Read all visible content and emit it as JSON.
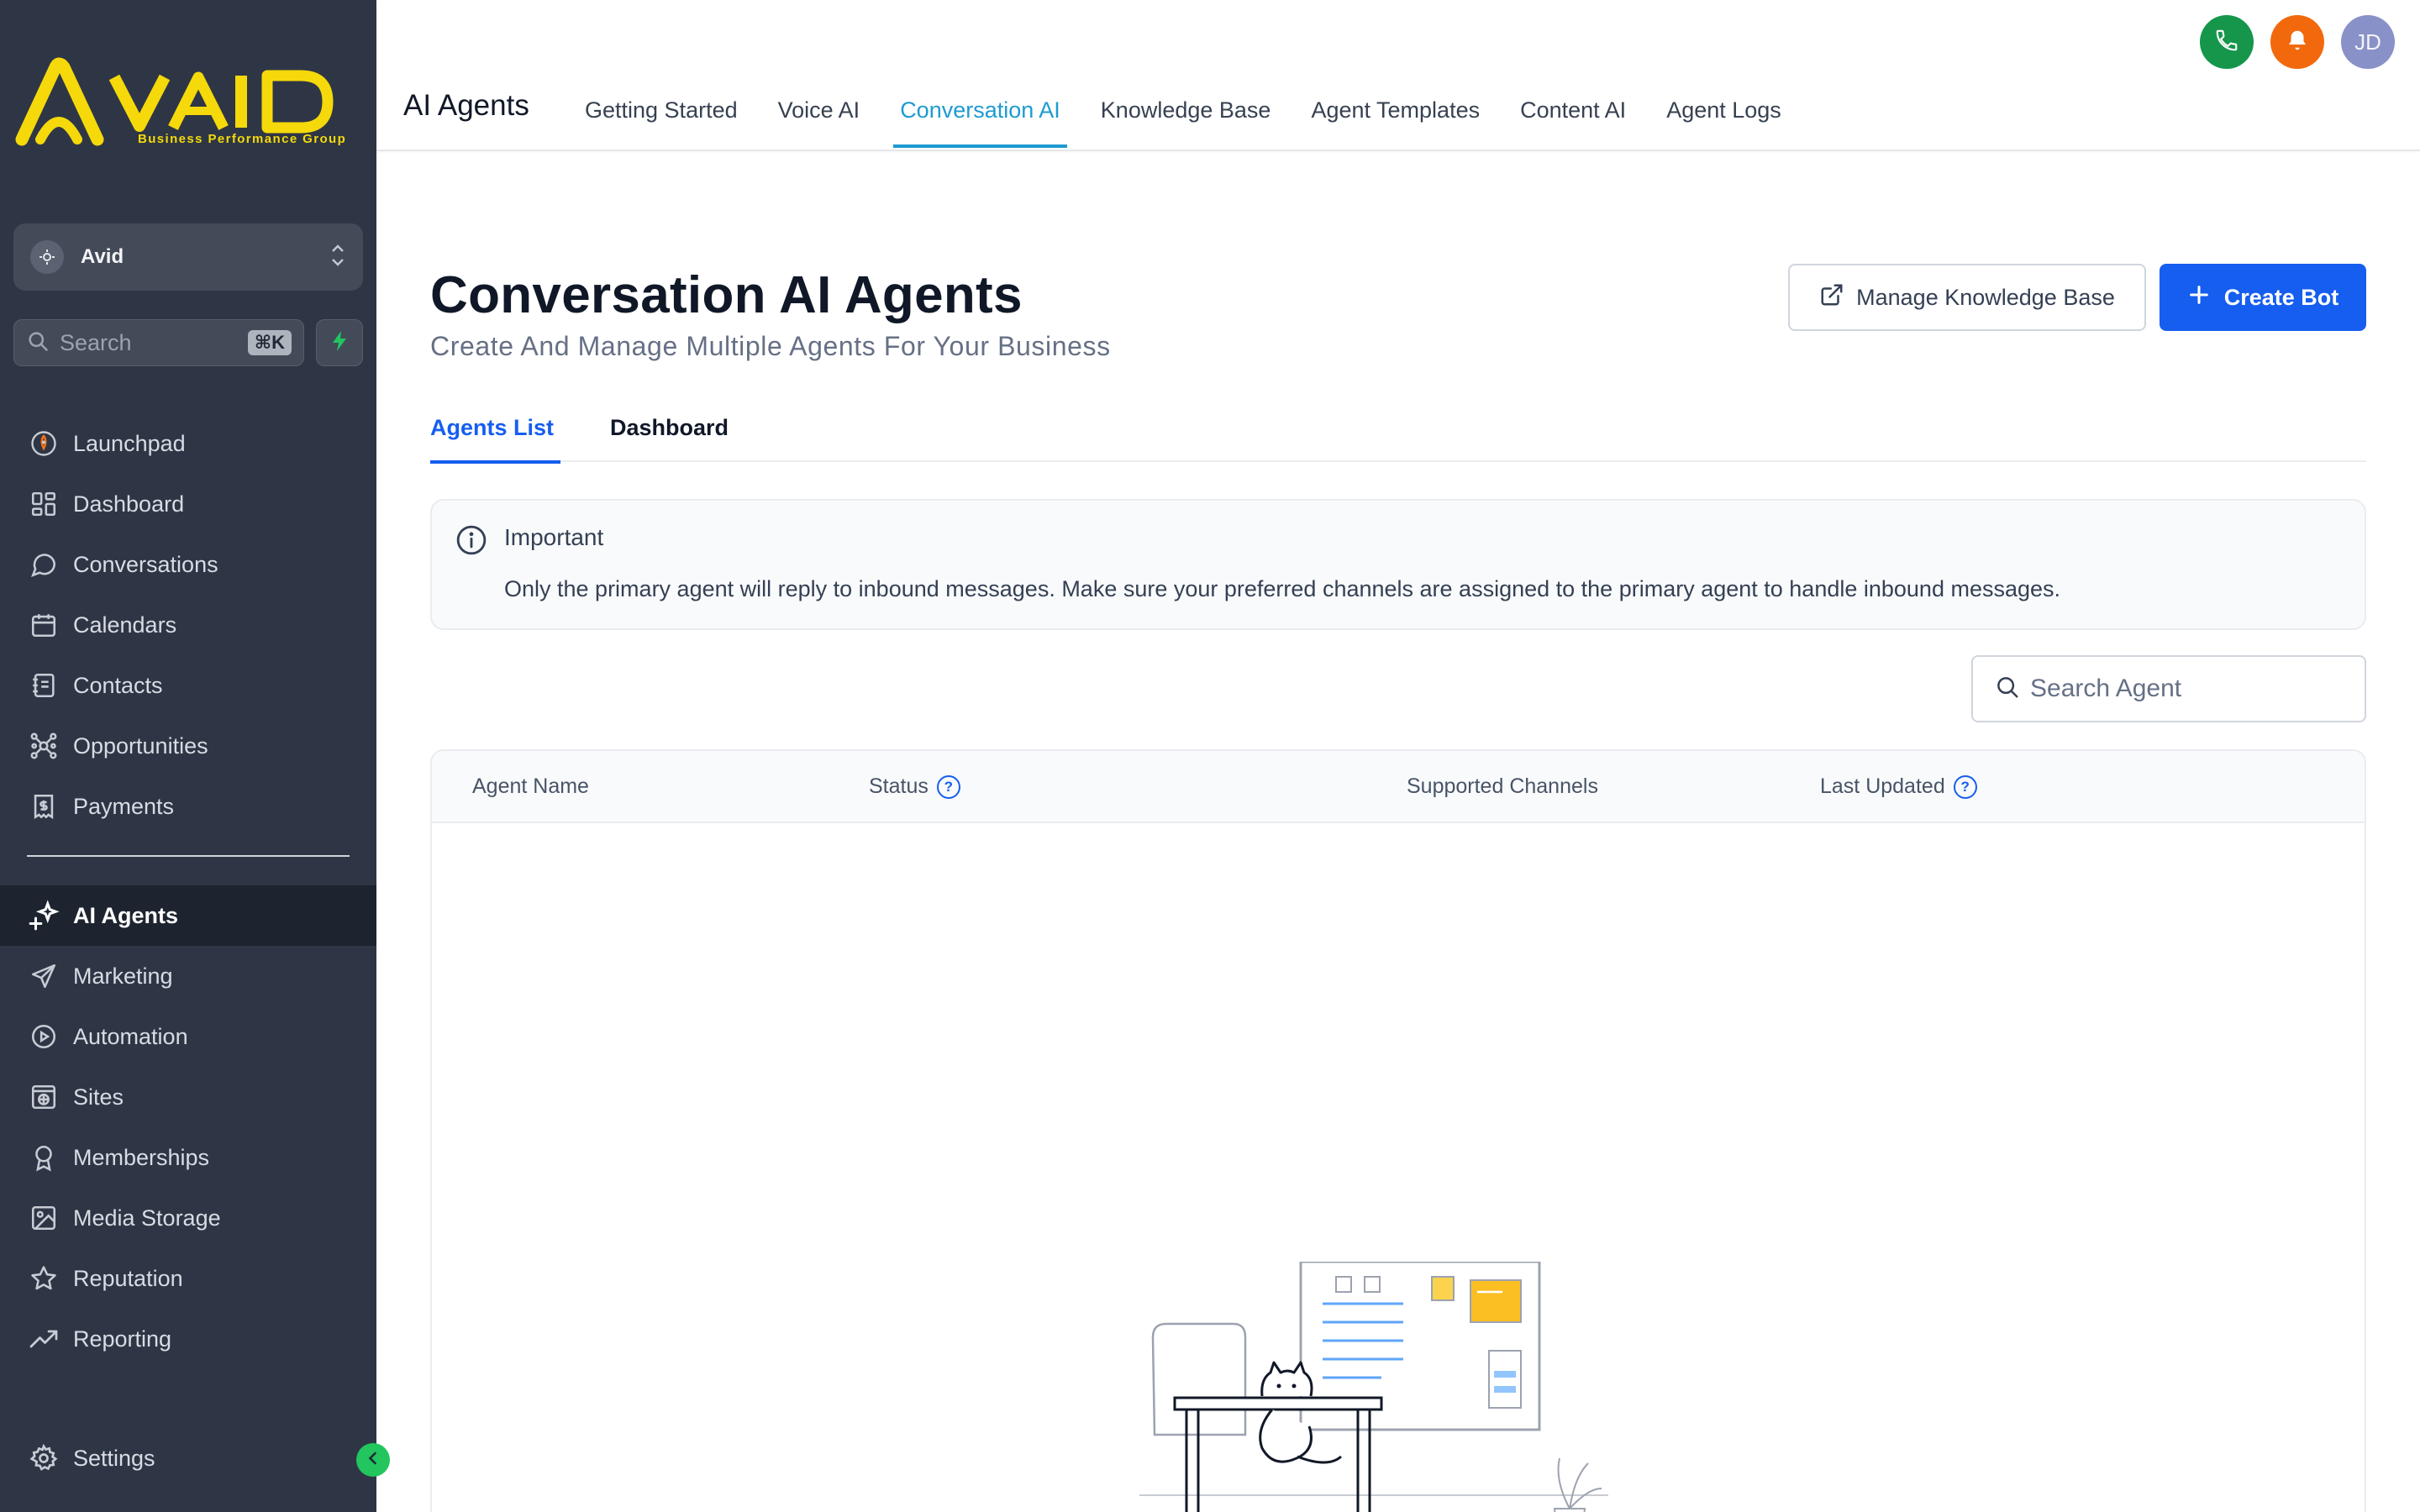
{
  "brand": {
    "name": "AVID",
    "tagline": "Business Performance Group",
    "accent_color": "#f5d90a"
  },
  "location": {
    "name": "Avid"
  },
  "search": {
    "placeholder": "Search",
    "shortcut": "⌘K"
  },
  "sidebar": {
    "items": [
      {
        "label": "Launchpad",
        "icon": "rocket-icon"
      },
      {
        "label": "Dashboard",
        "icon": "grid-icon"
      },
      {
        "label": "Conversations",
        "icon": "chat-bubble-icon"
      },
      {
        "label": "Calendars",
        "icon": "calendar-icon"
      },
      {
        "label": "Contacts",
        "icon": "contact-book-icon"
      },
      {
        "label": "Opportunities",
        "icon": "network-icon"
      },
      {
        "label": "Payments",
        "icon": "receipt-icon"
      }
    ],
    "items2": [
      {
        "label": "AI Agents",
        "icon": "sparkles-icon",
        "active": true
      },
      {
        "label": "Marketing",
        "icon": "send-icon"
      },
      {
        "label": "Automation",
        "icon": "play-circle-icon"
      },
      {
        "label": "Sites",
        "icon": "globe-window-icon"
      },
      {
        "label": "Memberships",
        "icon": "award-icon"
      },
      {
        "label": "Media Storage",
        "icon": "image-icon"
      },
      {
        "label": "Reputation",
        "icon": "star-icon"
      },
      {
        "label": "Reporting",
        "icon": "trending-up-icon"
      }
    ],
    "settings_label": "Settings"
  },
  "header": {
    "section_title": "AI Agents",
    "tabs": [
      {
        "label": "Getting Started"
      },
      {
        "label": "Voice AI"
      },
      {
        "label": "Conversation AI",
        "active": true
      },
      {
        "label": "Knowledge Base"
      },
      {
        "label": "Agent Templates"
      },
      {
        "label": "Content AI"
      },
      {
        "label": "Agent Logs"
      }
    ],
    "avatar_initials": "JD"
  },
  "page": {
    "title": "Conversation AI Agents",
    "subtitle": "Create And Manage Multiple Agents For Your Business",
    "manage_kb_label": "Manage Knowledge Base",
    "create_bot_label": "Create Bot",
    "primary_color": "#155eef"
  },
  "subtabs": {
    "agents_list": "Agents List",
    "dashboard": "Dashboard"
  },
  "alert": {
    "title": "Important",
    "body": "Only the primary agent will reply to inbound messages. Make sure your preferred channels are assigned to the primary agent to handle inbound messages."
  },
  "agent_search": {
    "placeholder": "Search Agent"
  },
  "table": {
    "columns": [
      "Agent Name",
      "Status",
      "Supported Channels",
      "Last Updated"
    ],
    "rows": []
  }
}
